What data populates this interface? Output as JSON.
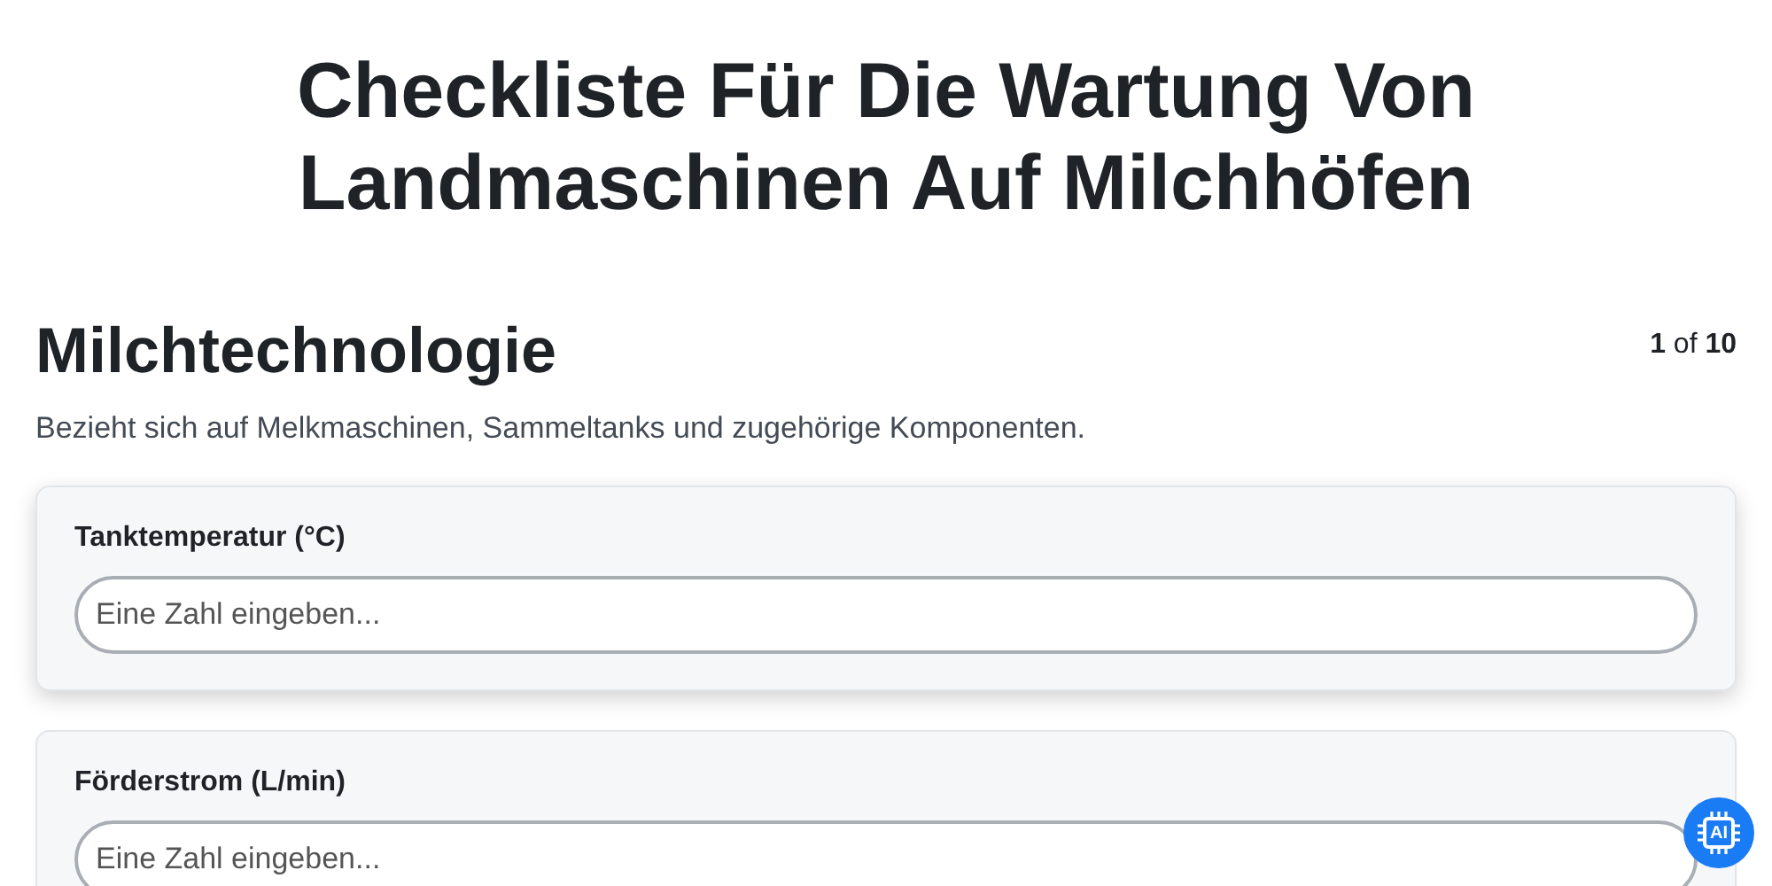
{
  "title": "Checkliste Für Die Wartung Von Landmaschinen Auf Milchhöfen",
  "section": {
    "heading": "Milchtechnologie",
    "pager": "**1** of **10**",
    "description": "Bezieht sich auf Melkmaschinen, Sammeltanks und zugehörige Komponenten."
  },
  "fields": [
    {
      "label": "Tanktemperatur (°C)",
      "placeholder": "Eine Zahl eingeben...",
      "active": true
    },
    {
      "label": "Förderstrom (L/min)",
      "placeholder": "Eine Zahl eingeben...",
      "active": false
    }
  ],
  "ai_badge": {
    "label": "AI"
  }
}
